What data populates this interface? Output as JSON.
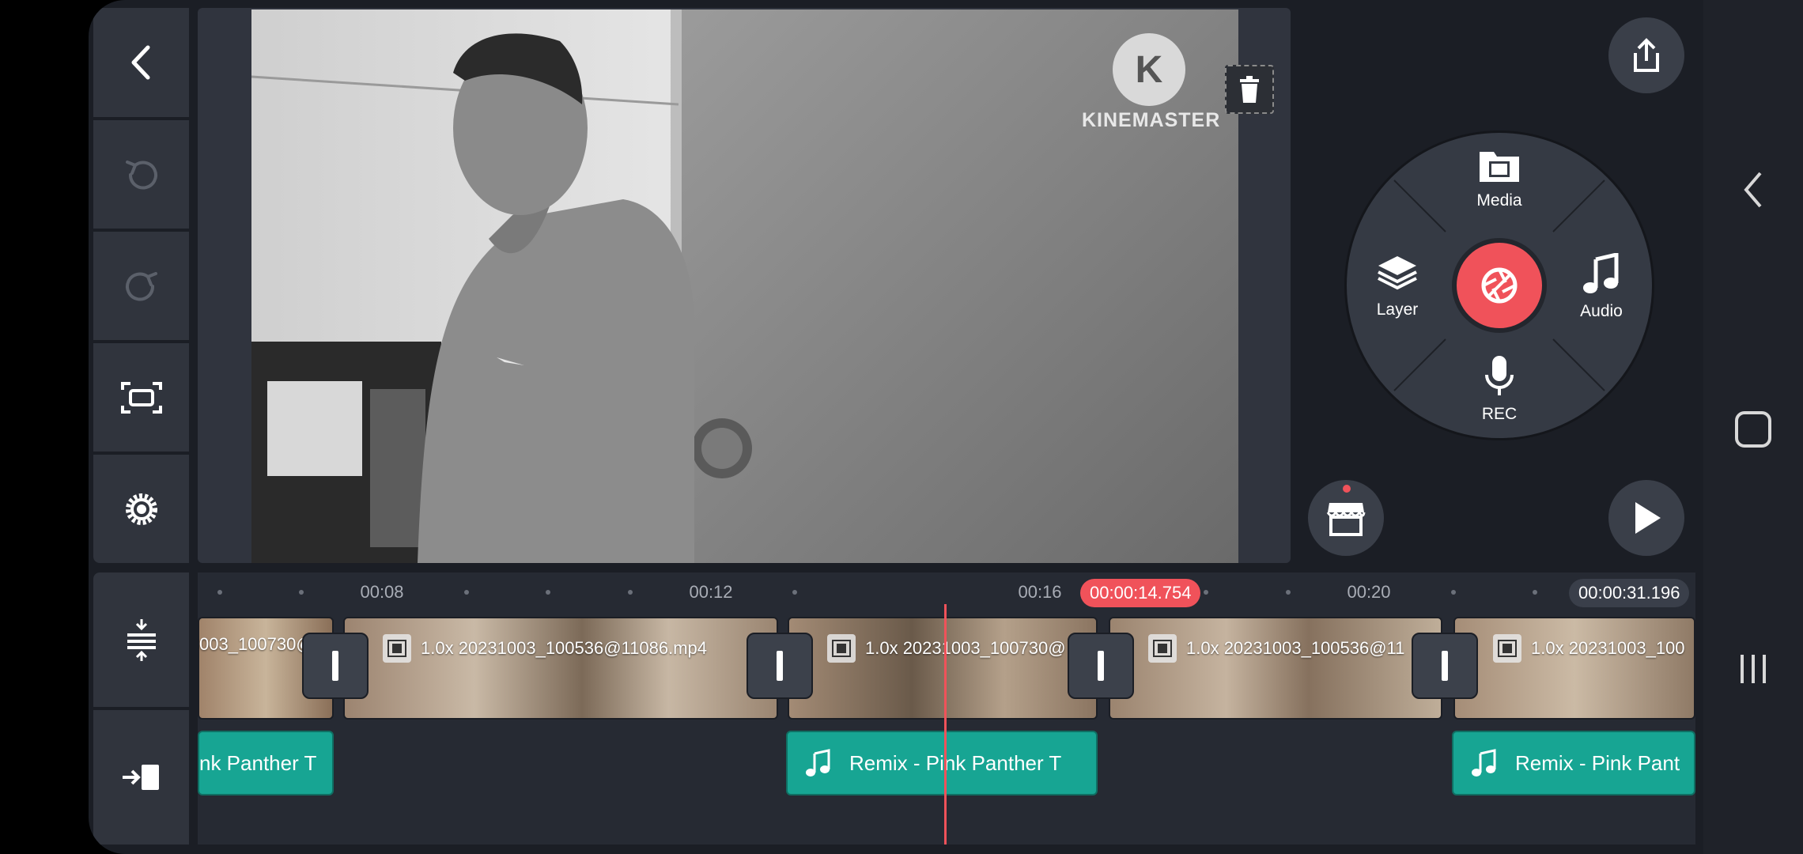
{
  "toolbar": {
    "back": "back-icon",
    "undo": "undo-icon",
    "redo": "redo-icon",
    "fit": "fit-screen-icon",
    "settings": "settings-icon",
    "adjust": "adjust-tracks-icon",
    "jump": "jump-to-end-icon"
  },
  "preview": {
    "watermark_text": "KINEMASTER",
    "watermark_letter": "K"
  },
  "dial": {
    "media_label": "Media",
    "layer_label": "Layer",
    "audio_label": "Audio",
    "rec_label": "REC",
    "center": "camera-icon"
  },
  "timeline": {
    "ruler_labels": [
      "00:08",
      "00:12",
      "00:16",
      "00:20"
    ],
    "playhead_time": "00:00:14.754",
    "total_time": "00:00:31.196",
    "clips": [
      {
        "label": "003_100730@"
      },
      {
        "label": "1.0x 20231003_100536@11086.mp4"
      },
      {
        "label": "1.0x 20231003_100730@"
      },
      {
        "label": "1.0x 20231003_100536@11"
      },
      {
        "label": "1.0x 20231003_100"
      }
    ],
    "audio": [
      {
        "label": "nk Panther T"
      },
      {
        "label": "Remix - Pink Panther T"
      },
      {
        "label": "Remix - Pink Pant"
      }
    ]
  },
  "colors": {
    "accent": "#f0525a",
    "audio_clip": "#17a593",
    "panel": "#30343d"
  }
}
